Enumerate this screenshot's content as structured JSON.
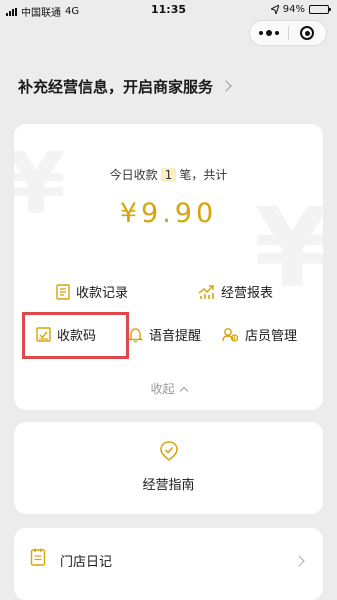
{
  "status_bar": {
    "carrier": "中国联通",
    "network": "4G",
    "time": "11:35",
    "battery": "94%",
    "battery_level": 0.94
  },
  "banner": {
    "text": "补充经营信息，开启商家服务"
  },
  "summary": {
    "prefix": "今日收款",
    "count": "1",
    "suffix": "笔，共计",
    "amount": "¥9.90"
  },
  "features": [
    {
      "label": "收款记录",
      "icon": "receipt-doc-icon"
    },
    {
      "label": "经营报表",
      "icon": "growth-chart-icon"
    },
    {
      "label": "收款码",
      "icon": "qr-collection-icon"
    },
    {
      "label": "语音提醒",
      "icon": "bell-icon"
    },
    {
      "label": "店员管理",
      "icon": "staff-icon"
    }
  ],
  "collapse_label": "收起",
  "guide": {
    "label": "经营指南",
    "icon": "guide-icon"
  },
  "diary": {
    "label": "门店日记",
    "icon": "diary-icon"
  },
  "colors": {
    "accent": "#d6a40c",
    "highlight_border": "#e0484e",
    "background": "#ececec"
  }
}
